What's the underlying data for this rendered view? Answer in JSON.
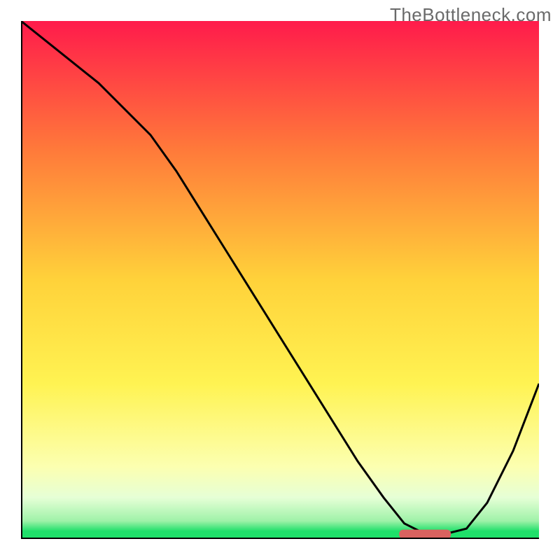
{
  "watermark": "TheBottleneck.com",
  "colors": {
    "top": "#ff1b4b",
    "mid_upper": "#ff7a3a",
    "mid": "#ffd23a",
    "mid_lower": "#fff67a",
    "pale": "#f7ffcf",
    "green": "#1fe06a",
    "curve": "#000000",
    "marker": "#d9625f",
    "axes": "#000000"
  },
  "chart_data": {
    "type": "line",
    "title": "",
    "xlabel": "",
    "ylabel": "",
    "xlim": [
      0,
      100
    ],
    "ylim": [
      0,
      100
    ],
    "gradient_stops": [
      {
        "offset": 0.0,
        "color": "#ff1b4b"
      },
      {
        "offset": 0.25,
        "color": "#ff7a3a"
      },
      {
        "offset": 0.5,
        "color": "#ffd23a"
      },
      {
        "offset": 0.7,
        "color": "#fff352"
      },
      {
        "offset": 0.86,
        "color": "#fcffb0"
      },
      {
        "offset": 0.92,
        "color": "#e6ffd6"
      },
      {
        "offset": 0.965,
        "color": "#9ff2a9"
      },
      {
        "offset": 0.985,
        "color": "#1fe06a"
      },
      {
        "offset": 1.0,
        "color": "#1fe06a"
      }
    ],
    "series": [
      {
        "name": "bottleneck-curve",
        "x": [
          0,
          5,
          10,
          15,
          20,
          25,
          30,
          35,
          40,
          45,
          50,
          55,
          60,
          65,
          70,
          74,
          78,
          82,
          86,
          90,
          95,
          100
        ],
        "y": [
          100,
          96,
          92,
          88,
          83,
          78,
          71,
          63,
          55,
          47,
          39,
          31,
          23,
          15,
          8,
          3,
          1,
          1,
          2,
          7,
          17,
          30
        ]
      }
    ],
    "marker": {
      "name": "optimal-range",
      "x_start": 73,
      "x_end": 83,
      "y": 1
    }
  }
}
